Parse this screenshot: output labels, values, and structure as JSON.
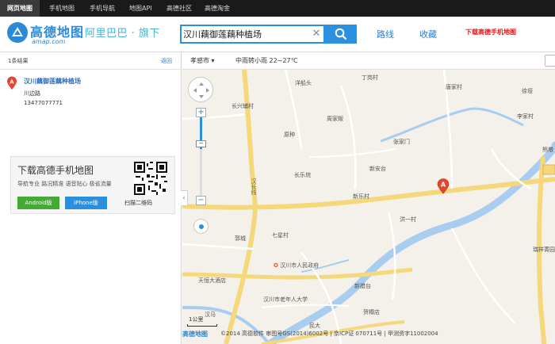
{
  "topnav": {
    "items": [
      "网页地图",
      "手机地图",
      "手机导航",
      "地图API",
      "高德社区",
      "高德淘金"
    ]
  },
  "header": {
    "logo_text": "高德地图",
    "logo_sub": "amap.com",
    "alibaba": "阿里巴巴 · 旗下",
    "search_value": "汉川藕御莲藕种植场",
    "route_label": "路线",
    "favorites_label": "收藏",
    "download_label": "下载高德手机地图"
  },
  "left_panel": {
    "results_count": "1条结果",
    "back_label": "返回",
    "result": {
      "marker": "A",
      "name": "汉川藕御莲藕种植场",
      "address": "川边路",
      "phone": "13477077771"
    },
    "ad": {
      "title": "下载高德手机地图",
      "subtitle": "导航专业 路况精准 语音贴心 极省流量",
      "android_label": "Android版",
      "iphone_label": "iPhone版",
      "qr_label": "扫描二维码"
    }
  },
  "map_toolbar": {
    "city": "孝感市 ▾",
    "weather": "中雨转小雨  22~27℃"
  },
  "map": {
    "marker": "A",
    "scale_label": "1公里",
    "footer_logo": "高德地图",
    "footer_text": "©2014 高德软件 审图号GS(2014)6002号 | 京ICP证 070711号 | 甲测资字11002004",
    "labels": [
      {
        "text": "洋船头"
      },
      {
        "text": "丁岗村"
      },
      {
        "text": "唐家村"
      },
      {
        "text": "徐垭"
      },
      {
        "text": "长兴辅村"
      },
      {
        "text": "李家村"
      },
      {
        "text": "周家贩"
      },
      {
        "text": "原种"
      },
      {
        "text": "张家门"
      },
      {
        "text": "熊墩"
      },
      {
        "text": "长乐垸"
      },
      {
        "text": "新安台"
      },
      {
        "text": "汉长线"
      },
      {
        "text": "新乐村"
      },
      {
        "text": "洪一村"
      },
      {
        "text": "郭城"
      },
      {
        "text": "七星村"
      },
      {
        "text": "汉川市人民政府"
      },
      {
        "text": "瑞祥菁园"
      },
      {
        "text": "天恒大酒店"
      },
      {
        "text": "新腊台"
      },
      {
        "text": "汉川市老年人大学"
      },
      {
        "text": "贺樽店"
      },
      {
        "text": "汉马"
      },
      {
        "text": "民大"
      }
    ]
  },
  "colors": {
    "brand_blue": "#2b90df",
    "link_blue": "#2b7fd0",
    "download_red": "#e0151d",
    "marker_red": "#e8432e",
    "road_yellow": "#f5d87c",
    "river_blue": "#a9cdef"
  }
}
